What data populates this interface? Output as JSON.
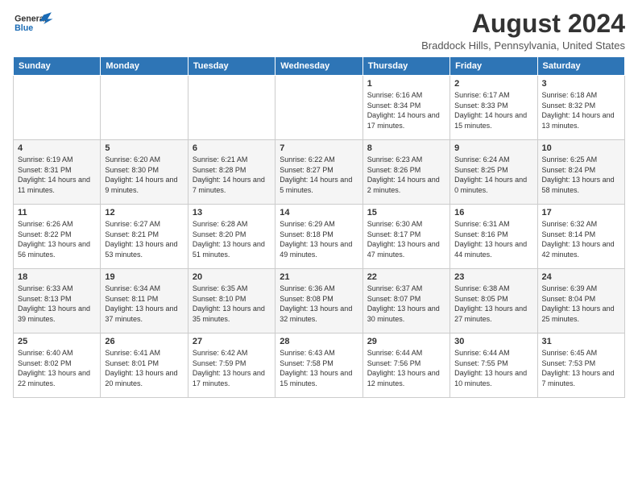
{
  "header": {
    "logo_general": "General",
    "logo_blue": "Blue",
    "month_year": "August 2024",
    "location": "Braddock Hills, Pennsylvania, United States"
  },
  "weekdays": [
    "Sunday",
    "Monday",
    "Tuesday",
    "Wednesday",
    "Thursday",
    "Friday",
    "Saturday"
  ],
  "weeks": [
    [
      {
        "day": "",
        "sunrise": "",
        "sunset": "",
        "daylight": ""
      },
      {
        "day": "",
        "sunrise": "",
        "sunset": "",
        "daylight": ""
      },
      {
        "day": "",
        "sunrise": "",
        "sunset": "",
        "daylight": ""
      },
      {
        "day": "",
        "sunrise": "",
        "sunset": "",
        "daylight": ""
      },
      {
        "day": "1",
        "sunrise": "Sunrise: 6:16 AM",
        "sunset": "Sunset: 8:34 PM",
        "daylight": "Daylight: 14 hours and 17 minutes."
      },
      {
        "day": "2",
        "sunrise": "Sunrise: 6:17 AM",
        "sunset": "Sunset: 8:33 PM",
        "daylight": "Daylight: 14 hours and 15 minutes."
      },
      {
        "day": "3",
        "sunrise": "Sunrise: 6:18 AM",
        "sunset": "Sunset: 8:32 PM",
        "daylight": "Daylight: 14 hours and 13 minutes."
      }
    ],
    [
      {
        "day": "4",
        "sunrise": "Sunrise: 6:19 AM",
        "sunset": "Sunset: 8:31 PM",
        "daylight": "Daylight: 14 hours and 11 minutes."
      },
      {
        "day": "5",
        "sunrise": "Sunrise: 6:20 AM",
        "sunset": "Sunset: 8:30 PM",
        "daylight": "Daylight: 14 hours and 9 minutes."
      },
      {
        "day": "6",
        "sunrise": "Sunrise: 6:21 AM",
        "sunset": "Sunset: 8:28 PM",
        "daylight": "Daylight: 14 hours and 7 minutes."
      },
      {
        "day": "7",
        "sunrise": "Sunrise: 6:22 AM",
        "sunset": "Sunset: 8:27 PM",
        "daylight": "Daylight: 14 hours and 5 minutes."
      },
      {
        "day": "8",
        "sunrise": "Sunrise: 6:23 AM",
        "sunset": "Sunset: 8:26 PM",
        "daylight": "Daylight: 14 hours and 2 minutes."
      },
      {
        "day": "9",
        "sunrise": "Sunrise: 6:24 AM",
        "sunset": "Sunset: 8:25 PM",
        "daylight": "Daylight: 14 hours and 0 minutes."
      },
      {
        "day": "10",
        "sunrise": "Sunrise: 6:25 AM",
        "sunset": "Sunset: 8:24 PM",
        "daylight": "Daylight: 13 hours and 58 minutes."
      }
    ],
    [
      {
        "day": "11",
        "sunrise": "Sunrise: 6:26 AM",
        "sunset": "Sunset: 8:22 PM",
        "daylight": "Daylight: 13 hours and 56 minutes."
      },
      {
        "day": "12",
        "sunrise": "Sunrise: 6:27 AM",
        "sunset": "Sunset: 8:21 PM",
        "daylight": "Daylight: 13 hours and 53 minutes."
      },
      {
        "day": "13",
        "sunrise": "Sunrise: 6:28 AM",
        "sunset": "Sunset: 8:20 PM",
        "daylight": "Daylight: 13 hours and 51 minutes."
      },
      {
        "day": "14",
        "sunrise": "Sunrise: 6:29 AM",
        "sunset": "Sunset: 8:18 PM",
        "daylight": "Daylight: 13 hours and 49 minutes."
      },
      {
        "day": "15",
        "sunrise": "Sunrise: 6:30 AM",
        "sunset": "Sunset: 8:17 PM",
        "daylight": "Daylight: 13 hours and 47 minutes."
      },
      {
        "day": "16",
        "sunrise": "Sunrise: 6:31 AM",
        "sunset": "Sunset: 8:16 PM",
        "daylight": "Daylight: 13 hours and 44 minutes."
      },
      {
        "day": "17",
        "sunrise": "Sunrise: 6:32 AM",
        "sunset": "Sunset: 8:14 PM",
        "daylight": "Daylight: 13 hours and 42 minutes."
      }
    ],
    [
      {
        "day": "18",
        "sunrise": "Sunrise: 6:33 AM",
        "sunset": "Sunset: 8:13 PM",
        "daylight": "Daylight: 13 hours and 39 minutes."
      },
      {
        "day": "19",
        "sunrise": "Sunrise: 6:34 AM",
        "sunset": "Sunset: 8:11 PM",
        "daylight": "Daylight: 13 hours and 37 minutes."
      },
      {
        "day": "20",
        "sunrise": "Sunrise: 6:35 AM",
        "sunset": "Sunset: 8:10 PM",
        "daylight": "Daylight: 13 hours and 35 minutes."
      },
      {
        "day": "21",
        "sunrise": "Sunrise: 6:36 AM",
        "sunset": "Sunset: 8:08 PM",
        "daylight": "Daylight: 13 hours and 32 minutes."
      },
      {
        "day": "22",
        "sunrise": "Sunrise: 6:37 AM",
        "sunset": "Sunset: 8:07 PM",
        "daylight": "Daylight: 13 hours and 30 minutes."
      },
      {
        "day": "23",
        "sunrise": "Sunrise: 6:38 AM",
        "sunset": "Sunset: 8:05 PM",
        "daylight": "Daylight: 13 hours and 27 minutes."
      },
      {
        "day": "24",
        "sunrise": "Sunrise: 6:39 AM",
        "sunset": "Sunset: 8:04 PM",
        "daylight": "Daylight: 13 hours and 25 minutes."
      }
    ],
    [
      {
        "day": "25",
        "sunrise": "Sunrise: 6:40 AM",
        "sunset": "Sunset: 8:02 PM",
        "daylight": "Daylight: 13 hours and 22 minutes."
      },
      {
        "day": "26",
        "sunrise": "Sunrise: 6:41 AM",
        "sunset": "Sunset: 8:01 PM",
        "daylight": "Daylight: 13 hours and 20 minutes."
      },
      {
        "day": "27",
        "sunrise": "Sunrise: 6:42 AM",
        "sunset": "Sunset: 7:59 PM",
        "daylight": "Daylight: 13 hours and 17 minutes."
      },
      {
        "day": "28",
        "sunrise": "Sunrise: 6:43 AM",
        "sunset": "Sunset: 7:58 PM",
        "daylight": "Daylight: 13 hours and 15 minutes."
      },
      {
        "day": "29",
        "sunrise": "Sunrise: 6:44 AM",
        "sunset": "Sunset: 7:56 PM",
        "daylight": "Daylight: 13 hours and 12 minutes."
      },
      {
        "day": "30",
        "sunrise": "Sunrise: 6:44 AM",
        "sunset": "Sunset: 7:55 PM",
        "daylight": "Daylight: 13 hours and 10 minutes."
      },
      {
        "day": "31",
        "sunrise": "Sunrise: 6:45 AM",
        "sunset": "Sunset: 7:53 PM",
        "daylight": "Daylight: 13 hours and 7 minutes."
      }
    ]
  ]
}
